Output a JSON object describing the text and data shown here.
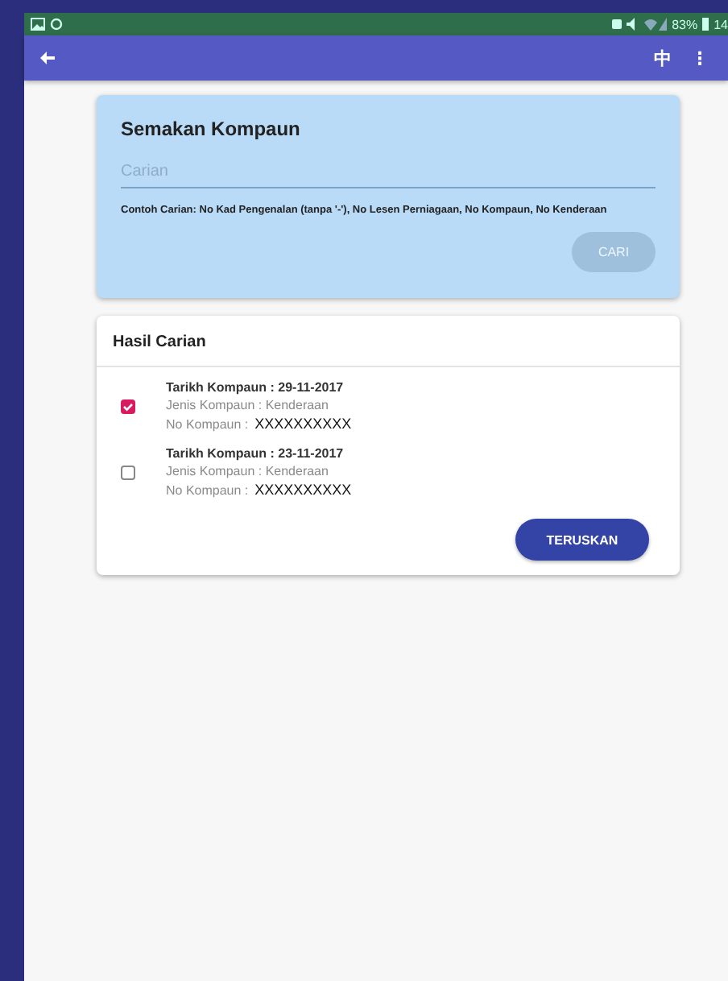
{
  "status_bar": {
    "battery": "83%",
    "time": "14"
  },
  "app_bar": {
    "language": "中",
    "menu": "⋮"
  },
  "search_card": {
    "title": "Semakan Kompaun",
    "field": {
      "placeholder": "Carian"
    },
    "hint": "Contoh Carian: No Kad Pengenalan (tanpa '-'), No Lesen Perniagaan, No Kompaun, No Kenderaan",
    "button": {
      "label": "CARI",
      "disabled": true
    }
  },
  "results_card": {
    "title": "Hasil Carian",
    "items": [
      {
        "date": "Tarikh Kompaun : 29-11-2017",
        "type": "Jenis Kompaun : Kenderaan",
        "number_label": "No Kompaun :",
        "number": "XXXXXXXXXX",
        "checked": true
      },
      {
        "date": "Tarikh Kompaun : 23-11-2017",
        "type": "Jenis Kompaun : Kenderaan",
        "number_label": "No Kompaun :",
        "number": "XXXXXXXXXX",
        "checked": false
      }
    ],
    "button": {
      "label": "TERUSKAN"
    }
  }
}
